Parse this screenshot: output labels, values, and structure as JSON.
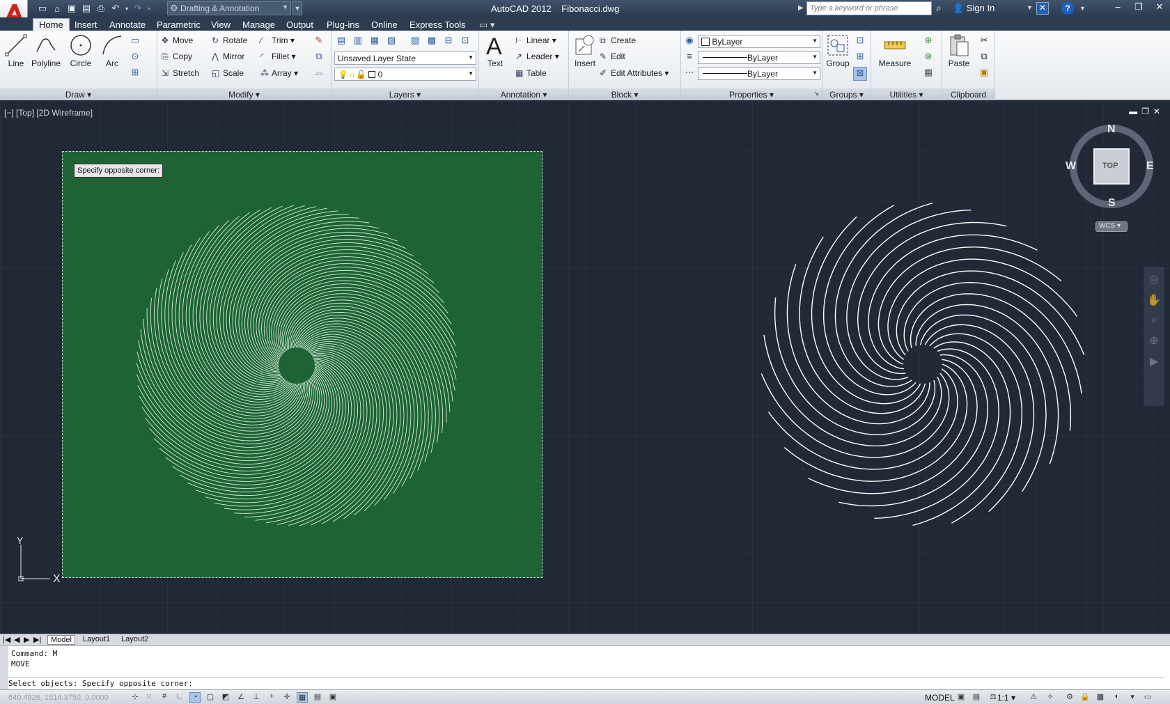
{
  "title": {
    "app": "AutoCAD 2012",
    "file": "Fibonacci.dwg",
    "workspace": "Drafting & Annotation",
    "search_placeholder": "Type a keyword or phrase",
    "sign_in": "Sign In"
  },
  "tabs": [
    "Home",
    "Insert",
    "Annotate",
    "Parametric",
    "View",
    "Manage",
    "Output",
    "Plug-ins",
    "Online",
    "Express Tools"
  ],
  "draw": {
    "line": "Line",
    "polyline": "Polyline",
    "circle": "Circle",
    "arc": "Arc",
    "footer": "Draw"
  },
  "modify": {
    "move": "Move",
    "rotate": "Rotate",
    "trim": "Trim",
    "copy": "Copy",
    "mirror": "Mirror",
    "fillet": "Fillet",
    "stretch": "Stretch",
    "scale": "Scale",
    "array": "Array",
    "footer": "Modify"
  },
  "layers": {
    "state": "Unsaved Layer State",
    "current": "0",
    "footer": "Layers"
  },
  "annotation": {
    "text": "Text",
    "linear": "Linear",
    "leader": "Leader",
    "table": "Table",
    "footer": "Annotation"
  },
  "block": {
    "insert": "Insert",
    "create": "Create",
    "edit": "Edit",
    "edit_attributes": "Edit Attributes",
    "footer": "Block"
  },
  "properties": {
    "color": "ByLayer",
    "linetype": "ByLayer",
    "lineweight": "ByLayer",
    "footer": "Properties"
  },
  "groups": {
    "group": "Group",
    "footer": "Groups"
  },
  "utilities": {
    "measure": "Measure",
    "footer": "Utilities"
  },
  "clipboard": {
    "paste": "Paste",
    "footer": "Clipboard"
  },
  "viewport": {
    "label": "[−] [Top] [2D Wireframe]",
    "tooltip": "Specify opposite corner:"
  },
  "viewcube": {
    "n": "N",
    "s": "S",
    "e": "E",
    "w": "W",
    "top": "TOP",
    "wcs": "WCS"
  },
  "ucs": {
    "y": "Y",
    "x": "X"
  },
  "layout_tabs": [
    "Model",
    "Layout1",
    "Layout2"
  ],
  "command": {
    "line1": "Command: M",
    "line2": "MOVE",
    "line3": "Select objects: Specify opposite corner:"
  },
  "status": {
    "coords": "640.4926, 1514.3750, 0.0000",
    "model": "MODEL",
    "scale": "1:1"
  },
  "colors": {
    "selection_fill": "#1d6334",
    "spiral": "#ffffff",
    "spiral_selected": "#d8f0dc",
    "background": "#212836"
  }
}
